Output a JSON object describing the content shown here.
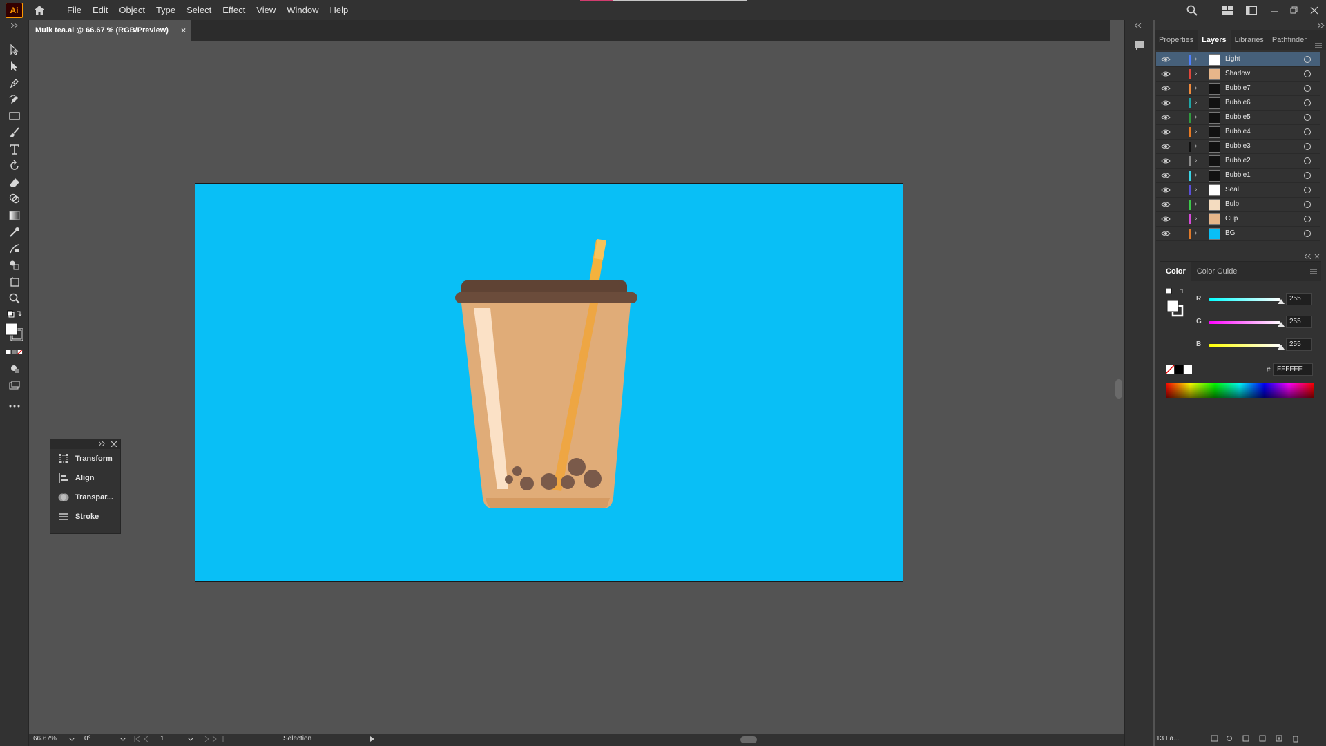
{
  "app": {
    "logo_text": "Ai",
    "menu": [
      "File",
      "Edit",
      "Object",
      "Type",
      "Select",
      "Effect",
      "View",
      "Window",
      "Help"
    ]
  },
  "document": {
    "tab_title": "Mulk tea.ai @ 66.67 % (RGB/Preview)",
    "close_glyph": "×"
  },
  "floating_panel": {
    "items": [
      {
        "label": "Transform",
        "icon": "transform-icon"
      },
      {
        "label": "Align",
        "icon": "align-icon"
      },
      {
        "label": "Transpar...",
        "icon": "transparency-icon"
      },
      {
        "label": "Stroke",
        "icon": "stroke-icon"
      }
    ]
  },
  "right_panel": {
    "tabs": [
      "Properties",
      "Layers",
      "Libraries",
      "Pathfinder"
    ],
    "active_tab": "Layers",
    "layers": [
      {
        "name": "Light",
        "color": "#4f80ff",
        "thumb": "#ffffff",
        "selected": true
      },
      {
        "name": "Shadow",
        "color": "#e0463a",
        "thumb": "#e6b68a",
        "selected": false
      },
      {
        "name": "Bubble7",
        "color": "#f08a3c",
        "thumb": "#111111",
        "selected": false
      },
      {
        "name": "Bubble6",
        "color": "#1fa6a6",
        "thumb": "#111111",
        "selected": false
      },
      {
        "name": "Bubble5",
        "color": "#2f9a3f",
        "thumb": "#111111",
        "selected": false
      },
      {
        "name": "Bubble4",
        "color": "#e87a22",
        "thumb": "#111111",
        "selected": false
      },
      {
        "name": "Bubble3",
        "color": "#111111",
        "thumb": "#111111",
        "selected": false
      },
      {
        "name": "Bubble2",
        "color": "#8c8c8c",
        "thumb": "#111111",
        "selected": false
      },
      {
        "name": "Bubble1",
        "color": "#3cd6e6",
        "thumb": "#111111",
        "selected": false
      },
      {
        "name": "Seal",
        "color": "#5a4fd8",
        "thumb": "#ffffff",
        "selected": false
      },
      {
        "name": "Bulb",
        "color": "#3cc84a",
        "thumb": "#f4dcc0",
        "selected": false
      },
      {
        "name": "Cup",
        "color": "#d54ad8",
        "thumb": "#e6b68a",
        "selected": false
      },
      {
        "name": "BG",
        "color": "#e07a2a",
        "thumb": "#09bff6",
        "selected": false
      }
    ],
    "footer_label": "13 La..."
  },
  "color_panel": {
    "tabs": [
      "Color",
      "Color Guide"
    ],
    "active_tab": "Color",
    "channels": [
      {
        "label": "R",
        "value": "255",
        "gradient": "linear-gradient(to right,#00ffff,#ffffff)"
      },
      {
        "label": "G",
        "value": "255",
        "gradient": "linear-gradient(to right,#ff00ff,#ffffff)"
      },
      {
        "label": "B",
        "value": "255",
        "gradient": "linear-gradient(to right,#ffff00,#ffffff)"
      }
    ],
    "hash": "#",
    "hex": "FFFFFF"
  },
  "statusbar": {
    "zoom": "66.67%",
    "rotation": "0°",
    "artboard": "1",
    "tool": "Selection"
  },
  "artwork": {
    "background": "#09bff6",
    "cup": "#e0ac78",
    "lid": "#6b4c3b",
    "straw": "#f4b23d",
    "boba": "#7a5a4a",
    "light": "#fbe1c6"
  }
}
